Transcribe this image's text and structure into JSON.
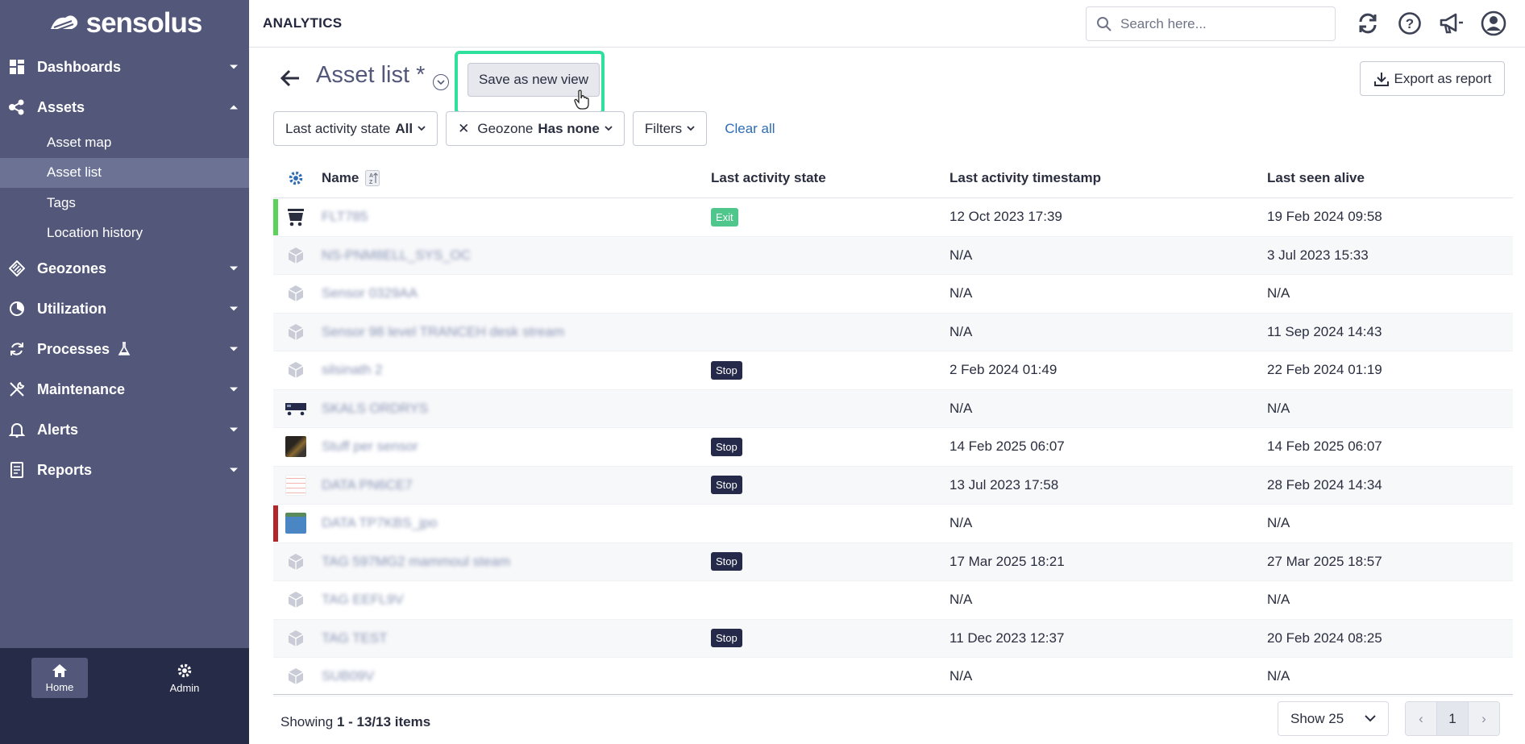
{
  "brand": {
    "name": "sensolus"
  },
  "sidebar": {
    "items": [
      {
        "label": "Dashboards",
        "icon": "dashboard-icon",
        "expanded": false
      },
      {
        "label": "Assets",
        "icon": "assets-icon",
        "expanded": true,
        "children": [
          {
            "label": "Asset map"
          },
          {
            "label": "Asset list",
            "active": true
          },
          {
            "label": "Tags"
          },
          {
            "label": "Location history"
          }
        ]
      },
      {
        "label": "Geozones",
        "icon": "geozone-icon",
        "expanded": false
      },
      {
        "label": "Utilization",
        "icon": "utilization-icon",
        "expanded": false
      },
      {
        "label": "Processes",
        "icon": "processes-icon",
        "expanded": false,
        "extra_icon": "flask-icon"
      },
      {
        "label": "Maintenance",
        "icon": "maintenance-icon",
        "expanded": false
      },
      {
        "label": "Alerts",
        "icon": "bell-icon",
        "expanded": false
      },
      {
        "label": "Reports",
        "icon": "reports-icon",
        "expanded": false
      }
    ],
    "footer": {
      "home_label": "Home",
      "admin_label": "Admin"
    }
  },
  "header": {
    "title": "ANALYTICS",
    "search_placeholder": "Search here..."
  },
  "page": {
    "title": "Asset list *",
    "save_label": "Save as new view",
    "export_label": "Export as report"
  },
  "filters": {
    "activity_label": "Last activity state",
    "activity_value": "All",
    "geozone_label": "Geozone",
    "geozone_value": "Has none",
    "filters_label": "Filters",
    "clear_label": "Clear all"
  },
  "table": {
    "columns": [
      "Name",
      "Last activity state",
      "Last activity timestamp",
      "Last seen alive"
    ],
    "rows": [
      {
        "name": "FLT785",
        "state": "Exit",
        "timestamp": "12 Oct 2023 17:39",
        "seen": "19 Feb 2024 09:58",
        "bar": "#5bd35a",
        "icon": "cart"
      },
      {
        "name": "NS-PNM8ELL_SYS_OC",
        "state": "",
        "timestamp": "N/A",
        "seen": "3 Jul 2023 15:33",
        "bar": "",
        "icon": "box"
      },
      {
        "name": "Sensor 0329AA",
        "state": "",
        "timestamp": "N/A",
        "seen": "N/A",
        "bar": "",
        "icon": "box"
      },
      {
        "name": "Sensor 98 level TRANCEH desk stream",
        "state": "",
        "timestamp": "N/A",
        "seen": "11 Sep 2024 14:43",
        "bar": "",
        "icon": "box"
      },
      {
        "name": "silsinath 2",
        "state": "Stop",
        "timestamp": "2 Feb 2024 01:49",
        "seen": "22 Feb 2024 01:19",
        "bar": "",
        "icon": "box"
      },
      {
        "name": "SKALS ORDRYS",
        "state": "",
        "timestamp": "N/A",
        "seen": "N/A",
        "bar": "",
        "icon": "truck"
      },
      {
        "name": "Stuff per sensor",
        "state": "Stop",
        "timestamp": "14 Feb 2025 06:07",
        "seen": "14 Feb 2025 06:07",
        "bar": "",
        "icon": "photo-dark"
      },
      {
        "name": "DATA PN6CE7",
        "state": "Stop",
        "timestamp": "13 Jul 2023 17:58",
        "seen": "28 Feb 2024 14:34",
        "bar": "",
        "icon": "photo-doc"
      },
      {
        "name": "DATA TP7KBS_jpo",
        "state": "",
        "timestamp": "N/A",
        "seen": "N/A",
        "bar": "#b3262b",
        "icon": "photo-blue"
      },
      {
        "name": "TAG 597MG2 mammoul steam",
        "state": "Stop",
        "timestamp": "17 Mar 2025 18:21",
        "seen": "27 Mar 2025 18:57",
        "bar": "",
        "icon": "box"
      },
      {
        "name": "TAG EEFL9V",
        "state": "",
        "timestamp": "N/A",
        "seen": "N/A",
        "bar": "",
        "icon": "box"
      },
      {
        "name": "TAG TEST",
        "state": "Stop",
        "timestamp": "11 Dec 2023 12:37",
        "seen": "20 Feb 2024 08:25",
        "bar": "",
        "icon": "box"
      },
      {
        "name": "SUB09V",
        "state": "",
        "timestamp": "N/A",
        "seen": "N/A",
        "bar": "",
        "icon": "box"
      }
    ]
  },
  "footer": {
    "showing_prefix": "Showing",
    "showing_range": "1 - 13/13 items",
    "page_size": "Show 25",
    "current_page": "1",
    "prev": "‹",
    "next": "›"
  },
  "colors": {
    "sidebar": "#53587a",
    "sidebar_footer": "#262b47",
    "highlight": "#2ee09c",
    "link": "#2e6cb5",
    "exit_badge": "#4fc78c",
    "stop_badge": "#252a4a"
  }
}
